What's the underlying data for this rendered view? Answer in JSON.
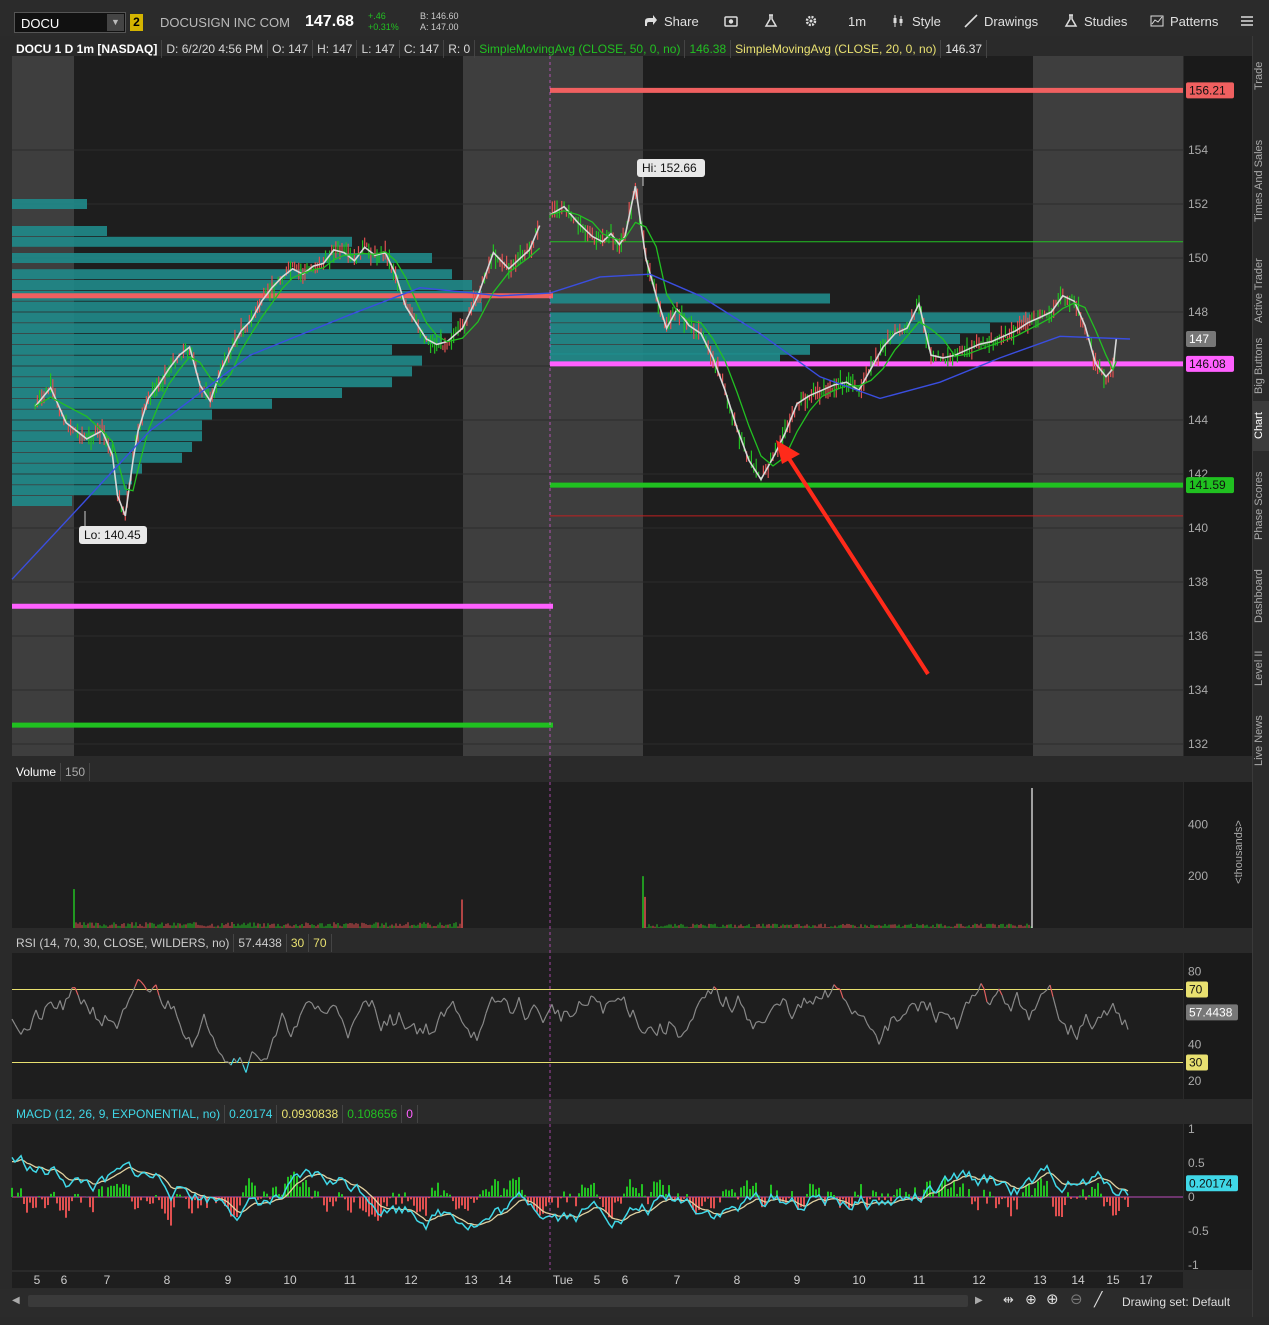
{
  "toolbar": {
    "symbol": "DOCU",
    "link_number": "2",
    "company": "DOCUSIGN INC COM",
    "last": "147.68",
    "change": "+.46",
    "change_pct": "+0.31%",
    "bid": "B: 146.60",
    "ask": "A: 147.00",
    "buttons": [
      "Share",
      "1m",
      "Style",
      "Drawings",
      "Studies",
      "Patterns"
    ]
  },
  "side_tabs": [
    "Trade",
    "Times And Sales",
    "Active Trader",
    "Big Buttons",
    "Chart",
    "Phase Scores",
    "Dashboard",
    "Level II",
    "Live News"
  ],
  "price_legend": {
    "title": "DOCU 1 D 1m [NASDAQ]",
    "date": "D: 6/2/20 4:56 PM",
    "open": "O: 147",
    "high": "H: 147",
    "low": "L: 147",
    "close": "C: 147",
    "range": "R: 0",
    "sma50_label": "SimpleMovingAvg (CLOSE, 50, 0, no)",
    "sma50_value": "146.38",
    "sma20_label": "SimpleMovingAvg (CLOSE, 20, 0, no)",
    "sma20_value": "146.37"
  },
  "volume_legend": {
    "label": "Volume",
    "value": "150"
  },
  "rsi_legend": {
    "label": "RSI (14, 70, 30, CLOSE, WILDERS, no)",
    "value": "57.4438",
    "ob": "30",
    "os": "70"
  },
  "macd_legend": {
    "label": "MACD (12, 26, 9, EXPONENTIAL, no)",
    "value": "0.20174",
    "avg": "0.0930838",
    "diff": "0.108656",
    "zero": "0"
  },
  "drawing_set": "Drawing set: Default",
  "colors": {
    "bg": "#1e1e1e",
    "extended": "#3e3e3e",
    "up": "#22c022",
    "down": "#e05050",
    "profile": "#1f8a8a",
    "sma50": "#3a4ee0",
    "sma20": "#d8d8d8",
    "green_ma": "#22c022",
    "level_red": "#f06060",
    "level_magenta": "#ff60ff",
    "level_green": "#20c020",
    "rsi_line": "#888888",
    "macd": "#40d8e8",
    "macd_avg": "#e0d0a0",
    "arrow": "#ff2a1a"
  },
  "chart_data": {
    "type": "candlestick",
    "title": "DOCU 1 D 1m [NASDAQ]",
    "x_ticks": [
      "5",
      "6",
      "7",
      "8",
      "9",
      "10",
      "11",
      "12",
      "13",
      "14",
      "Tue",
      "5",
      "6",
      "7",
      "8",
      "9",
      "10",
      "11",
      "12",
      "13",
      "14",
      "15",
      "17"
    ],
    "price_axis": {
      "min": 132,
      "max": 156,
      "ticks": [
        132,
        134,
        136,
        138,
        140,
        142,
        144,
        146,
        148,
        150,
        152,
        154
      ]
    },
    "annotations": {
      "high": "Hi: 152.66",
      "low": "Lo: 140.45"
    },
    "levels": [
      {
        "price": 156.21,
        "label": "156.21",
        "color": "#f06060",
        "scope": "day2"
      },
      {
        "price": 148.6,
        "label": "",
        "color": "#f06060",
        "scope": "day1"
      },
      {
        "price": 146.08,
        "label": "146.08",
        "color": "#ff60ff",
        "scope": "day2"
      },
      {
        "price": 137.1,
        "label": "",
        "color": "#ff60ff",
        "scope": "day1"
      },
      {
        "price": 141.59,
        "label": "141.59",
        "color": "#20c020",
        "scope": "day2"
      },
      {
        "price": 132.7,
        "label": "",
        "color": "#20c020",
        "scope": "day1"
      }
    ],
    "current_price_label": "147",
    "series_close_day1": [
      [
        5.0,
        144.5
      ],
      [
        5.3,
        145.2
      ],
      [
        5.6,
        143.9
      ],
      [
        6.0,
        143.3
      ],
      [
        6.3,
        143.6
      ],
      [
        6.5,
        142.7
      ],
      [
        6.6,
        141.2
      ],
      [
        6.75,
        140.45
      ],
      [
        6.9,
        142.5
      ],
      [
        7.0,
        143.6
      ],
      [
        7.2,
        144.8
      ],
      [
        7.4,
        145.3
      ],
      [
        7.6,
        145.9
      ],
      [
        7.8,
        146.4
      ],
      [
        8.0,
        146.7
      ],
      [
        8.2,
        145.3
      ],
      [
        8.4,
        144.7
      ],
      [
        8.6,
        145.8
      ],
      [
        8.8,
        146.6
      ],
      [
        9.0,
        147.3
      ],
      [
        9.2,
        147.7
      ],
      [
        9.4,
        148.4
      ],
      [
        9.6,
        148.9
      ],
      [
        9.8,
        149.3
      ],
      [
        10.0,
        149.6
      ],
      [
        10.2,
        149.4
      ],
      [
        10.4,
        149.7
      ],
      [
        10.6,
        149.8
      ],
      [
        10.8,
        150.3
      ],
      [
        11.0,
        150.2
      ],
      [
        11.2,
        149.9
      ],
      [
        11.4,
        150.4
      ],
      [
        11.6,
        150.1
      ],
      [
        11.8,
        150.2
      ],
      [
        12.0,
        149.4
      ],
      [
        12.2,
        148.2
      ],
      [
        12.4,
        147.6
      ],
      [
        12.6,
        147.0
      ],
      [
        12.8,
        146.8
      ],
      [
        13.0,
        146.9
      ],
      [
        13.3,
        147.4
      ],
      [
        13.6,
        148.6
      ],
      [
        13.9,
        150.2
      ],
      [
        14.2,
        149.6
      ],
      [
        14.6,
        150.3
      ],
      [
        14.8,
        151.2
      ]
    ],
    "series_close_day2": [
      [
        0.0,
        151.6
      ],
      [
        0.3,
        151.9
      ],
      [
        0.6,
        151.3
      ],
      [
        0.9,
        150.8
      ],
      [
        1.2,
        150.6
      ],
      [
        1.5,
        150.9
      ],
      [
        1.8,
        150.5
      ],
      [
        2.0,
        150.8
      ],
      [
        2.2,
        152.66
      ],
      [
        2.4,
        150.0
      ],
      [
        2.6,
        148.6
      ],
      [
        2.8,
        147.4
      ],
      [
        3.0,
        148.1
      ],
      [
        3.2,
        147.5
      ],
      [
        3.4,
        147.2
      ],
      [
        3.6,
        146.3
      ],
      [
        3.8,
        145.1
      ],
      [
        4.0,
        143.7
      ],
      [
        4.2,
        142.5
      ],
      [
        4.4,
        141.8
      ],
      [
        4.6,
        142.6
      ],
      [
        4.8,
        143.5
      ],
      [
        5.0,
        144.6
      ],
      [
        5.2,
        144.9
      ],
      [
        5.4,
        145.1
      ],
      [
        5.6,
        145.3
      ],
      [
        5.8,
        145.4
      ],
      [
        6.0,
        145.1
      ],
      [
        6.2,
        145.9
      ],
      [
        6.4,
        146.7
      ],
      [
        6.6,
        147.2
      ],
      [
        6.8,
        147.4
      ],
      [
        7.0,
        148.3
      ],
      [
        7.2,
        146.4
      ],
      [
        7.4,
        146.3
      ],
      [
        7.6,
        146.4
      ],
      [
        7.8,
        146.6
      ],
      [
        8.0,
        146.8
      ],
      [
        8.2,
        146.9
      ],
      [
        8.4,
        147.1
      ],
      [
        8.6,
        147.3
      ],
      [
        8.8,
        147.6
      ],
      [
        9.0,
        147.8
      ],
      [
        9.3,
        148.0
      ],
      [
        9.6,
        148.6
      ],
      [
        9.9,
        148.4
      ],
      [
        10.2,
        147.5
      ],
      [
        10.5,
        146.1
      ],
      [
        10.8,
        145.6
      ],
      [
        11.0,
        145.9
      ],
      [
        11.2,
        147.0
      ]
    ],
    "volume": {
      "axis": {
        "min": 0,
        "max": 520,
        "ticks": [
          200,
          400
        ],
        "unit": "<thousands>"
      },
      "spikes": [
        {
          "x_label": "6",
          "value": 150
        },
        {
          "x_label": "6 (Tue)",
          "value": 200
        },
        {
          "x_label": "13 (Tue)",
          "value": 540
        }
      ]
    },
    "rsi": {
      "axis_ticks": [
        20,
        40,
        80
      ],
      "upper": 70,
      "lower": 30,
      "last": 57.4438
    },
    "macd": {
      "axis_ticks": [
        -1,
        -0.5,
        0,
        0.5,
        1
      ],
      "last": 0.20174
    }
  }
}
